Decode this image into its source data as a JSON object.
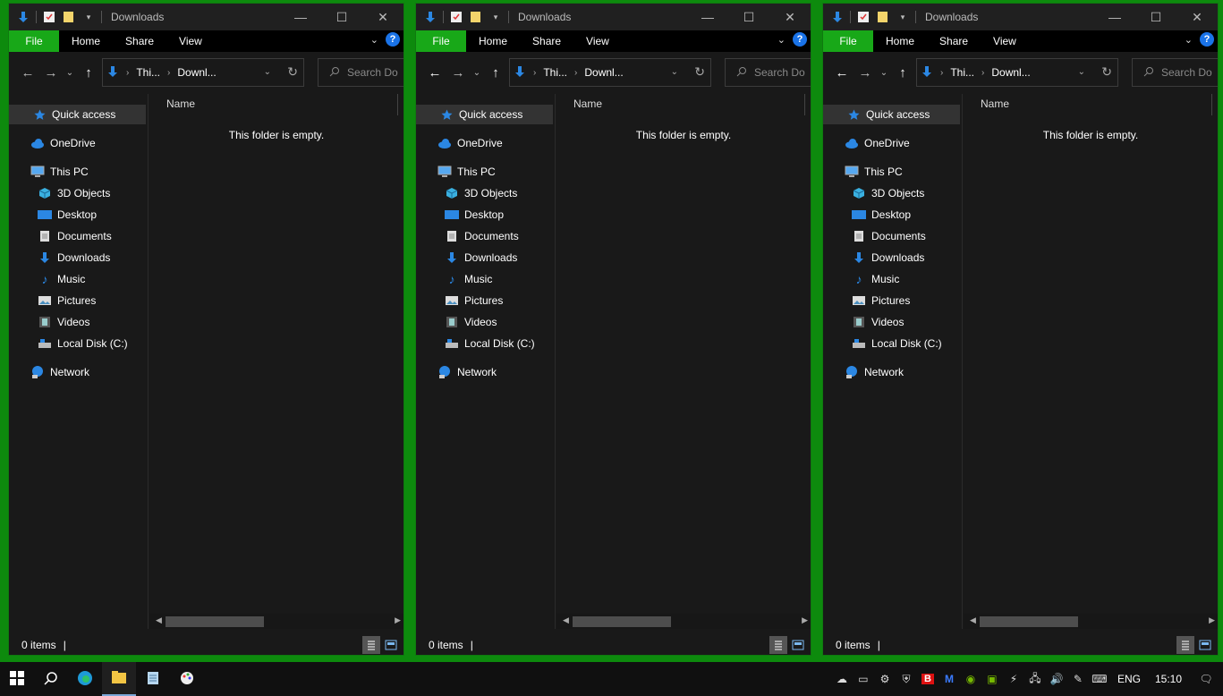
{
  "window": {
    "title": "Downloads",
    "minimize": "—",
    "maximize": "☐",
    "close": "✕"
  },
  "ribbon": {
    "tabs": [
      "File",
      "Home",
      "Share",
      "View"
    ],
    "help": "?"
  },
  "navigation": {
    "breadcrumb": [
      "Thi...",
      "Downl..."
    ],
    "search_placeholder": "Search Do"
  },
  "sidebar": {
    "quick_access": "Quick access",
    "onedrive": "OneDrive",
    "this_pc": "This PC",
    "this_pc_items": [
      "3D Objects",
      "Desktop",
      "Documents",
      "Downloads",
      "Music",
      "Pictures",
      "Videos",
      "Local Disk (C:)"
    ],
    "network": "Network"
  },
  "content": {
    "column_name": "Name",
    "empty_message": "This folder is empty."
  },
  "status": {
    "item_count": "0 items"
  },
  "taskbar": {
    "language": "ENG",
    "time": "15:10",
    "colors": {
      "accent": "#1aa31a",
      "file_tab": "#18a818",
      "folder_blue": "#2b87e3"
    }
  }
}
